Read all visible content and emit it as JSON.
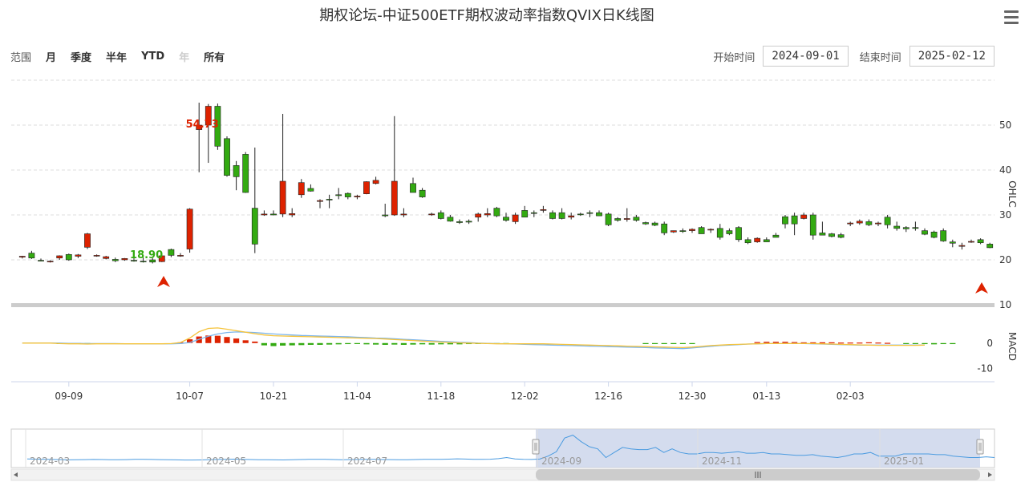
{
  "title": "期权论坛-中证500ETF期权波动率指数QVIX日K线图",
  "menu_icon": "hamburger-menu-icon",
  "range_selector": {
    "label": "范围",
    "buttons": [
      "月",
      "季度",
      "半年",
      "YTD",
      "年",
      "所有"
    ],
    "disabled": [
      "年"
    ]
  },
  "date_range": {
    "start_label": "开始时间",
    "start_value": "2024-09-01",
    "end_label": "结束时间",
    "end_value": "2025-02-12"
  },
  "colors": {
    "up": "#dd2200",
    "down": "#33aa11",
    "k_line": "#f5c33b",
    "d_line": "#7cb5ec",
    "navigator_fill": "#ccd6eb",
    "navigator_line": "#4b9be0"
  },
  "chart_data": {
    "type": "candlestick",
    "ylabel": "OHLC",
    "yticks": [
      10,
      20,
      30,
      40,
      50
    ],
    "ylim": [
      10,
      60
    ],
    "xticks": [
      "09-09",
      "10-07",
      "10-21",
      "11-04",
      "11-18",
      "12-02",
      "12-16",
      "12-30",
      "01-13",
      "02-03"
    ],
    "xtick_index": [
      5,
      18,
      27,
      36,
      45,
      54,
      63,
      72,
      80,
      89
    ],
    "flags": [
      {
        "label": "18.90",
        "index": 13,
        "color": "#33aa11"
      },
      {
        "label": "54.73",
        "index": 19,
        "color": "#dd2200"
      }
    ],
    "ohlc": [
      [
        20.6,
        20.9,
        20.3,
        20.8
      ],
      [
        21.5,
        22.0,
        20.2,
        20.4
      ],
      [
        19.9,
        20.3,
        19.7,
        19.8
      ],
      [
        19.6,
        19.9,
        19.4,
        19.7
      ],
      [
        20.4,
        21.0,
        20.0,
        20.9
      ],
      [
        21.2,
        21.4,
        19.8,
        20.0
      ],
      [
        20.8,
        21.3,
        20.4,
        21.1
      ],
      [
        22.8,
        26.0,
        22.4,
        25.8
      ],
      [
        20.9,
        21.2,
        20.7,
        21.0
      ],
      [
        20.3,
        20.9,
        20.1,
        20.7
      ],
      [
        20.1,
        20.5,
        19.5,
        19.8
      ],
      [
        20.0,
        20.4,
        19.8,
        20.3
      ],
      [
        19.9,
        20.7,
        19.6,
        19.8
      ],
      [
        19.7,
        20.5,
        19.4,
        19.6
      ],
      [
        20.0,
        20.4,
        19.2,
        19.5
      ],
      [
        19.6,
        21.0,
        19.5,
        20.9
      ],
      [
        22.3,
        22.5,
        20.6,
        21.0
      ],
      [
        21.0,
        21.5,
        20.7,
        21.0
      ],
      [
        22.4,
        31.5,
        21.6,
        31.3
      ],
      [
        49.0,
        55.0,
        39.5,
        50.0
      ],
      [
        50.0,
        54.7,
        41.6,
        54.2
      ],
      [
        54.2,
        54.8,
        44.5,
        45.3
      ],
      [
        47.0,
        47.5,
        38.5,
        38.8
      ],
      [
        41.0,
        42.0,
        35.5,
        38.5
      ],
      [
        43.5,
        44.0,
        34.9,
        35.0
      ],
      [
        31.5,
        45.0,
        21.5,
        23.5
      ],
      [
        30.0,
        31.0,
        29.8,
        30.2
      ],
      [
        30.2,
        31.0,
        29.9,
        30.0
      ],
      [
        30.2,
        52.5,
        29.5,
        37.5
      ],
      [
        30.0,
        31.5,
        29.5,
        30.3
      ],
      [
        34.5,
        38.0,
        33.8,
        37.2
      ],
      [
        35.9,
        36.8,
        35.2,
        35.3
      ],
      [
        33.0,
        33.5,
        31.5,
        33.2
      ],
      [
        33.5,
        34.5,
        31.5,
        33.4
      ],
      [
        34.5,
        36.0,
        33.5,
        34.3
      ],
      [
        34.8,
        35.0,
        33.5,
        34.0
      ],
      [
        34.0,
        34.5,
        33.5,
        34.2
      ],
      [
        34.7,
        37.5,
        34.6,
        37.4
      ],
      [
        37.0,
        38.5,
        36.8,
        37.7
      ],
      [
        30.0,
        32.5,
        29.5,
        29.8
      ],
      [
        30.0,
        52.0,
        29.8,
        37.5
      ],
      [
        30.0,
        31.5,
        29.5,
        30.2
      ],
      [
        37.0,
        38.3,
        36.5,
        35.0
      ],
      [
        35.5,
        36.0,
        33.8,
        34.0
      ],
      [
        30.1,
        30.5,
        29.8,
        30.2
      ],
      [
        30.5,
        31.0,
        29.0,
        29.2
      ],
      [
        29.5,
        30.0,
        28.5,
        28.6
      ],
      [
        28.5,
        29.0,
        28.0,
        28.3
      ],
      [
        28.6,
        29.0,
        28.0,
        28.4
      ],
      [
        29.5,
        30.5,
        28.5,
        30.2
      ],
      [
        30.0,
        31.5,
        29.5,
        30.3
      ],
      [
        31.5,
        31.8,
        29.5,
        29.8
      ],
      [
        29.5,
        30.5,
        28.5,
        28.8
      ],
      [
        28.5,
        30.5,
        28.0,
        30.0
      ],
      [
        31.0,
        32.0,
        30.5,
        29.5
      ],
      [
        30.5,
        31.0,
        29.5,
        30.4
      ],
      [
        31.0,
        32.0,
        30.5,
        31.2
      ],
      [
        30.5,
        31.0,
        29.0,
        29.2
      ],
      [
        30.5,
        31.5,
        29.0,
        29.2
      ],
      [
        29.5,
        30.5,
        29.0,
        29.8
      ],
      [
        30.2,
        30.5,
        29.8,
        30.1
      ],
      [
        30.5,
        31.0,
        29.5,
        30.4
      ],
      [
        30.5,
        31.0,
        29.8,
        29.8
      ],
      [
        30.2,
        30.5,
        27.5,
        27.8
      ],
      [
        29.2,
        29.5,
        28.5,
        28.8
      ],
      [
        29.0,
        31.5,
        28.5,
        29.2
      ],
      [
        29.5,
        30.0,
        28.5,
        28.8
      ],
      [
        28.3,
        28.5,
        27.8,
        28.0
      ],
      [
        28.2,
        28.5,
        27.5,
        27.7
      ],
      [
        28.0,
        28.5,
        25.5,
        26.0
      ],
      [
        26.2,
        26.5,
        26.0,
        26.5
      ],
      [
        26.5,
        27.0,
        26.0,
        26.3
      ],
      [
        26.5,
        27.0,
        26.0,
        26.8
      ],
      [
        27.2,
        27.5,
        25.8,
        25.8
      ],
      [
        26.8,
        27.0,
        26.0,
        26.8
      ],
      [
        27.0,
        28.0,
        24.5,
        25.0
      ],
      [
        26.5,
        27.0,
        25.5,
        25.8
      ],
      [
        27.2,
        27.5,
        24.0,
        24.5
      ],
      [
        24.5,
        25.0,
        23.5,
        23.8
      ],
      [
        24.0,
        25.0,
        23.8,
        24.8
      ],
      [
        24.5,
        25.0,
        24.0,
        24.0
      ],
      [
        25.5,
        26.0,
        25.2,
        25.0
      ],
      [
        29.6,
        30.0,
        27.0,
        28.0
      ],
      [
        29.8,
        30.5,
        25.5,
        28.0
      ],
      [
        29.2,
        30.5,
        29.0,
        30.0
      ],
      [
        30.0,
        30.5,
        24.5,
        25.5
      ],
      [
        26.0,
        28.5,
        25.5,
        25.5
      ],
      [
        25.8,
        26.0,
        25.0,
        25.2
      ],
      [
        25.6,
        26.0,
        24.8,
        25.0
      ],
      [
        28.0,
        28.5,
        27.5,
        28.2
      ],
      [
        28.2,
        29.0,
        27.8,
        28.6
      ],
      [
        28.5,
        29.0,
        27.5,
        27.8
      ],
      [
        28.0,
        28.5,
        27.5,
        28.2
      ],
      [
        29.5,
        30.0,
        27.0,
        27.8
      ],
      [
        27.5,
        28.5,
        26.5,
        27.0
      ],
      [
        27.2,
        27.5,
        26.2,
        26.9
      ],
      [
        27.2,
        28.5,
        26.5,
        27.0
      ],
      [
        26.5,
        27.0,
        25.5,
        25.7
      ],
      [
        26.2,
        26.5,
        24.8,
        25.0
      ],
      [
        26.5,
        27.0,
        24.0,
        24.2
      ],
      [
        24.0,
        24.5,
        22.8,
        23.7
      ],
      [
        23.0,
        23.8,
        22.3,
        23.2
      ],
      [
        24.0,
        24.5,
        23.8,
        24.1
      ],
      [
        24.5,
        24.8,
        23.5,
        23.8
      ],
      [
        23.5,
        23.8,
        22.6,
        22.7
      ]
    ],
    "macd": {
      "ylabel": "MACD",
      "yticks": [
        0,
        -10
      ],
      "ylim": [
        -15,
        12
      ],
      "bars": [
        0,
        0,
        0,
        0,
        -0.3,
        -0.2,
        -0.2,
        -0.3,
        0,
        0,
        0,
        0,
        0,
        0,
        0,
        0,
        0,
        0.3,
        1.5,
        2.6,
        3.0,
        2.9,
        2.4,
        1.8,
        1.1,
        0.6,
        -0.9,
        -1.2,
        -1.0,
        -0.9,
        -0.8,
        -0.7,
        -0.7,
        -0.6,
        -0.5,
        -0.4,
        -0.3,
        -0.5,
        -0.6,
        -0.7,
        -0.6,
        -0.7,
        -0.6,
        -0.5,
        -0.6,
        -0.5,
        -0.5,
        -0.5,
        -0.4,
        -0.3,
        -0.2,
        -0.1,
        -0.1,
        0,
        0,
        0,
        0,
        0,
        0,
        0,
        0,
        0,
        0,
        0,
        0,
        0,
        0,
        -0.1,
        -0.2,
        -0.2,
        -0.2,
        -0.2,
        -0.1,
        0,
        0,
        0,
        0,
        0,
        0,
        0.4,
        0.5,
        0.5,
        0.5,
        0.4,
        0.3,
        0.3,
        0.3,
        0.3,
        0.2,
        0.2,
        0.2,
        0.3,
        0.2,
        0.1,
        0,
        -0.1,
        -0.3,
        -0.4,
        -0.5,
        -0.4,
        -0.4
      ],
      "k": [
        0,
        0,
        0,
        0,
        -0.2,
        -0.3,
        -0.3,
        -0.4,
        -0.3,
        -0.3,
        -0.3,
        -0.3,
        -0.3,
        -0.3,
        -0.3,
        -0.3,
        -0.2,
        0.2,
        2.0,
        4.5,
        5.8,
        6.0,
        5.5,
        4.9,
        4.3,
        3.7,
        3.2,
        2.9,
        2.8,
        2.7,
        2.6,
        2.5,
        2.4,
        2.3,
        2.2,
        2.1,
        2.0,
        1.9,
        1.8,
        1.6,
        1.4,
        1.2,
        1.0,
        0.8,
        0.6,
        0.4,
        0.2,
        0.1,
        0,
        -0.1,
        -0.2,
        -0.3,
        -0.3,
        -0.3,
        -0.3,
        -0.3,
        -0.3,
        -0.4,
        -0.5,
        -0.6,
        -0.7,
        -0.8,
        -0.9,
        -1.0,
        -1.1,
        -1.2,
        -1.3,
        -1.4,
        -1.5,
        -1.6,
        -1.7,
        -1.8,
        -1.6,
        -1.3,
        -1.0,
        -0.8,
        -0.6,
        -0.5,
        -0.4,
        -0.3,
        -0.2,
        -0.2,
        -0.2,
        -0.2,
        -0.2,
        -0.2,
        -0.3,
        -0.4,
        -0.5,
        -0.6,
        -0.7,
        -0.8,
        -0.9,
        -0.9,
        -0.9,
        -0.9,
        -0.9,
        -0.8
      ],
      "d": [
        0,
        0,
        0,
        0,
        0,
        -0.1,
        -0.1,
        -0.2,
        -0.2,
        -0.2,
        -0.2,
        -0.3,
        -0.3,
        -0.3,
        -0.3,
        -0.3,
        -0.3,
        -0.2,
        0.2,
        1.5,
        2.7,
        3.6,
        4.2,
        4.4,
        4.3,
        4.2,
        3.9,
        3.6,
        3.4,
        3.2,
        3.0,
        2.9,
        2.8,
        2.7,
        2.6,
        2.5,
        2.3,
        2.2,
        2.0,
        1.9,
        1.7,
        1.5,
        1.3,
        1.1,
        0.9,
        0.7,
        0.5,
        0.3,
        0.2,
        0,
        -0.1,
        -0.2,
        -0.3,
        -0.4,
        -0.5,
        -0.6,
        -0.7,
        -0.8,
        -0.9,
        -1.0,
        -1.1,
        -1.2,
        -1.3,
        -1.4,
        -1.5,
        -1.6,
        -1.7,
        -1.8,
        -1.9,
        -2.0,
        -2.1,
        -2.2,
        -1.9,
        -1.6,
        -1.3,
        -1.0,
        -0.8,
        -0.6,
        -0.4,
        -0.3,
        -0.2,
        -0.2,
        -0.2,
        -0.2,
        -0.2,
        -0.3,
        -0.4,
        -0.5,
        -0.6,
        -0.7,
        -0.8,
        -0.8,
        -0.8,
        -0.8,
        -0.8,
        -0.8,
        -0.8,
        -0.8
      ]
    },
    "navigator": {
      "labels": [
        "2024-03",
        "2024-05",
        "2024-07",
        "2024-09",
        "2024-11",
        "2025-01"
      ],
      "series": [
        21,
        20.8,
        20.5,
        20.3,
        20.1,
        19.8,
        19.9,
        20.1,
        20.3,
        20.2,
        20.0,
        19.9,
        20.1,
        20.4,
        20.6,
        20.3,
        20.1,
        20.0,
        19.8,
        19.6,
        19.5,
        19.7,
        20.0,
        20.3,
        20.6,
        20.8,
        20.5,
        20.2,
        20.0,
        19.9,
        19.8,
        19.7,
        20.0,
        20.2,
        20.4,
        20.6,
        20.4,
        20.2,
        20.0,
        20.1,
        20.3,
        20.5,
        20.4,
        20.2,
        20.1,
        20.0,
        19.9,
        20.2,
        20.5,
        20.6,
        20.4,
        20.8,
        21.2,
        20.9,
        20.6,
        20.4,
        20.7,
        21.5,
        23,
        21,
        20.5,
        20.3,
        20.9,
        25,
        31,
        50,
        54,
        45,
        38,
        35,
        23,
        30,
        37,
        35,
        34,
        34,
        37,
        30,
        35,
        30,
        28,
        28,
        30,
        30,
        29,
        30,
        31,
        29,
        29,
        30,
        28,
        28,
        27,
        26,
        26,
        27,
        25,
        24,
        23,
        25,
        28,
        28,
        30,
        25,
        25,
        25,
        28,
        28,
        28,
        28,
        27,
        27,
        25,
        24,
        23,
        23,
        24,
        23
      ]
    }
  }
}
